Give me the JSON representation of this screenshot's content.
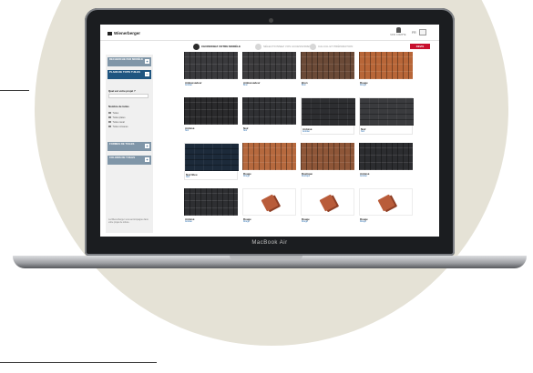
{
  "device": {
    "label": "MacBook Air"
  },
  "header": {
    "brand": "Wienerberger",
    "account_label": "MON COMPTE",
    "lang": "FR"
  },
  "steps": [
    {
      "label": "CHOISISSEZ VOTRE MODÈLE",
      "active": true
    },
    {
      "label": "SÉLECTIONNEZ VOS ACCESSOIRES",
      "active": false
    },
    {
      "label": "CALCUL ET PRÉPARATION",
      "active": false
    }
  ],
  "start_button": "DEVIS",
  "sidebar": {
    "filters": [
      {
        "label": "RECHERCHE PAR MODÈLE",
        "active": false
      },
      {
        "label": "PLANS DE TOITS TUILES",
        "active": true
      },
      {
        "label": "FORMES DE TUILES",
        "active": false
      },
      {
        "label": "COLORIS DE TUILES",
        "active": false
      }
    ],
    "question": "Quel est votre projet ?",
    "label2": "Nombre de tuiles",
    "checks": [
      "Tuiles",
      "Tuiles plates",
      "Tuiles canal",
      "Tuiles romanes"
    ],
    "footer": "La Wienerberger vous accompagne dans votre projet de toiture."
  },
  "products": [
    {
      "name": "Ambassadeur",
      "sub": "Ardoisé",
      "color": "#3a3a3d",
      "pattern": "ridged"
    },
    {
      "name": "Ambassadeur",
      "sub": "Brun",
      "color": "#3b3a3c",
      "pattern": "ridged"
    },
    {
      "name": "Brun",
      "sub": "Brun",
      "color": "#6b4a37",
      "pattern": "ridged"
    },
    {
      "name": "Rouge",
      "sub": "Rouge",
      "color": "#b86638",
      "pattern": "ridged"
    },
    {
      "name": "Ardoisé",
      "sub": "Noir",
      "color": "#2a2a2c",
      "pattern": "ridged"
    },
    {
      "name": "Noir",
      "sub": "Noir",
      "color": "#2f3033",
      "pattern": "ridged"
    },
    {
      "name": "Ardoisé",
      "sub": "Ardoisé",
      "color": "#2d2e31",
      "pattern": "flat"
    },
    {
      "name": "Noir",
      "sub": "Noir",
      "color": "#3a3b3e",
      "pattern": "flat"
    },
    {
      "name": "Noir Bleu",
      "sub": "Noir",
      "color": "#1c2a3a",
      "pattern": "flat"
    },
    {
      "name": "Rouge",
      "sub": "Rouge",
      "color": "#b6693e",
      "pattern": "ridged"
    },
    {
      "name": "Rustique",
      "sub": "Rustique",
      "color": "#8e5638",
      "pattern": "ridged"
    },
    {
      "name": "Ardoisé",
      "sub": "Ardoisé",
      "color": "#2c2d30",
      "pattern": "ridged"
    },
    {
      "name": "Ardoisé",
      "sub": "Ardoisé",
      "color": "#2e2f32",
      "pattern": "ridged"
    },
    {
      "name": "Rouge",
      "sub": "Rouge",
      "color": "#b95c3a",
      "pattern": "ceramic"
    },
    {
      "name": "Rouge",
      "sub": "Rouge",
      "color": "#b95c3a",
      "pattern": "ceramic"
    },
    {
      "name": "Rouge",
      "sub": "Rouge",
      "color": "#b95c3a",
      "pattern": "ceramic"
    }
  ]
}
